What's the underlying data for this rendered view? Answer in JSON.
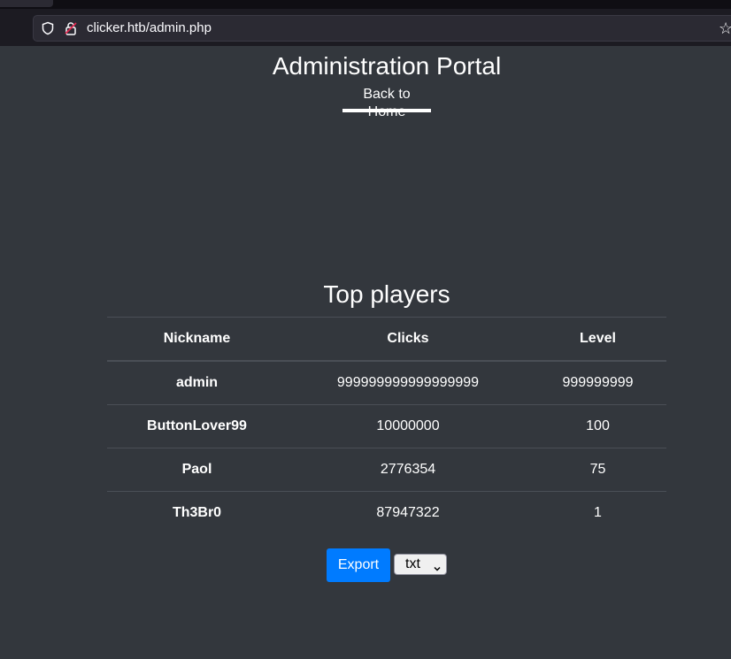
{
  "browser": {
    "url": "clicker.htb/admin.php",
    "star_glyph": "☆"
  },
  "header": {
    "title": "Administration Portal",
    "back_link": "Back to Home"
  },
  "leaderboard": {
    "title": "Top players",
    "columns": [
      "Nickname",
      "Clicks",
      "Level"
    ],
    "rows": [
      {
        "nickname": "admin",
        "clicks": "999999999999999999",
        "level": "999999999"
      },
      {
        "nickname": "ButtonLover99",
        "clicks": "10000000",
        "level": "100"
      },
      {
        "nickname": "Paol",
        "clicks": "2776354",
        "level": "75"
      },
      {
        "nickname": "Th3Br0",
        "clicks": "87947322",
        "level": "1"
      }
    ]
  },
  "export": {
    "button_label": "Export",
    "format_selected": "txt"
  },
  "colors": {
    "page_background": "#33373d",
    "accent": "#007bff"
  }
}
